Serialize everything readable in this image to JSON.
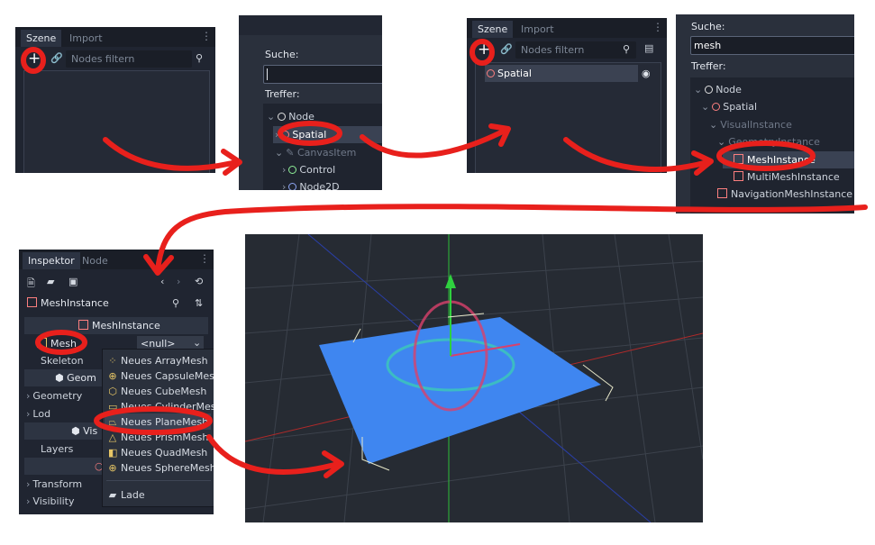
{
  "panel1": {
    "tabs": [
      "Szene",
      "Import"
    ],
    "filter_placeholder": "Nodes filtern",
    "add_glyph": "+"
  },
  "panel2": {
    "search_label": "Suche:",
    "search_value": "",
    "results_label": "Treffer:",
    "tree": [
      "Node",
      "Spatial",
      "CanvasItem",
      "Control",
      "Node2D"
    ]
  },
  "panel3": {
    "tabs": [
      "Szene",
      "Import"
    ],
    "filter_placeholder": "Nodes filtern",
    "add_glyph": "+",
    "node": "Spatial"
  },
  "panel4": {
    "search_label": "Suche:",
    "search_value": "mesh",
    "results_label": "Treffer:",
    "tree": [
      "Node",
      "Spatial",
      "VisualInstance",
      "GeometryInstance",
      "MeshInstance",
      "MultiMeshInstance",
      "NavigationMeshInstance"
    ]
  },
  "inspector": {
    "tabs": [
      "Inspektor",
      "Node"
    ],
    "object_name": "MeshInstance",
    "section_title": "MeshInstance",
    "properties": {
      "mesh_label": "Mesh",
      "mesh_value": "<null>",
      "skeleton_label": "Skeleton",
      "geometry_section": "Geom",
      "geometry": "Geometry",
      "lod": "Lod",
      "visual_section": "Vis",
      "layers": "Layers",
      "transform": "Transform",
      "visibility": "Visibility"
    },
    "menu_items": [
      {
        "icon": "array-mesh-icon",
        "label": "Neues ArrayMesh"
      },
      {
        "icon": "capsule-mesh-icon",
        "label": "Neues CapsuleMesh"
      },
      {
        "icon": "cube-mesh-icon",
        "label": "Neues CubeMesh"
      },
      {
        "icon": "cylinder-mesh-icon",
        "label": "Neues CylinderMesh"
      },
      {
        "icon": "plane-mesh-icon",
        "label": "Neues PlaneMesh"
      },
      {
        "icon": "prism-mesh-icon",
        "label": "Neues PrismMesh"
      },
      {
        "icon": "quad-mesh-icon",
        "label": "Neues QuadMesh"
      },
      {
        "icon": "sphere-mesh-icon",
        "label": "Neues SphereMesh"
      }
    ],
    "load_label": "Lade"
  },
  "viewport": {
    "plane_color": "#3f86f0",
    "annotation_color": "#e8201c"
  }
}
